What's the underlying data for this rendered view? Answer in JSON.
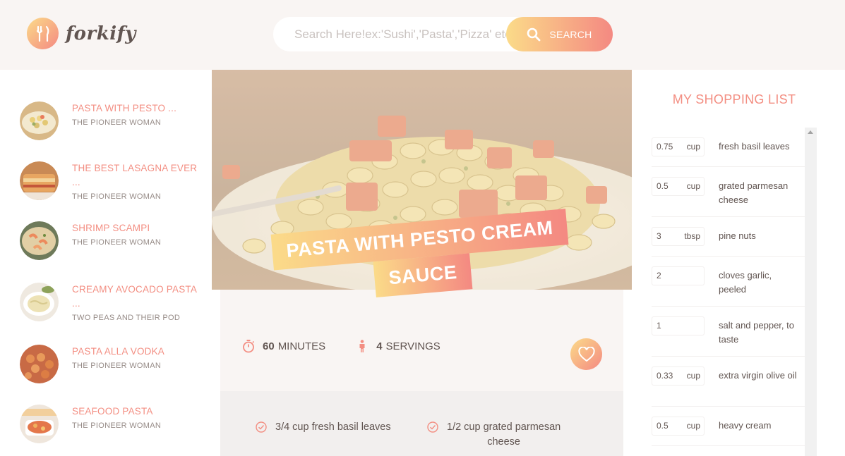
{
  "brand": {
    "name": "forkify",
    "gradient_start": "#fbdb89",
    "gradient_end": "#f48982",
    "accent": "#f38e82"
  },
  "search": {
    "placeholder": "Search Here!ex:'Sushi','Pasta','Pizza' etc",
    "button_label": "SEARCH",
    "icon": "search-icon"
  },
  "results": [
    {
      "title": "PASTA WITH PESTO ...",
      "author": "THE PIONEER WOMAN",
      "palette": "pasta-pesto"
    },
    {
      "title": "THE BEST LASAGNA EVER ...",
      "author": "THE PIONEER WOMAN",
      "palette": "lasagna"
    },
    {
      "title": "SHRIMP SCAMPI",
      "author": "THE PIONEER WOMAN",
      "palette": "shrimp"
    },
    {
      "title": "CREAMY AVOCADO PASTA ...",
      "author": "TWO PEAS AND THEIR POD",
      "palette": "avocado"
    },
    {
      "title": "PASTA ALLA VODKA",
      "author": "THE PIONEER WOMAN",
      "palette": "vodka"
    },
    {
      "title": "SEAFOOD PASTA",
      "author": "THE PIONEER WOMAN",
      "palette": "seafood"
    }
  ],
  "recipe": {
    "title_line1": "PASTA WITH PESTO CREAM",
    "title_line2": "SAUCE",
    "minutes": "60",
    "minutes_label": "MINUTES",
    "servings": "4",
    "servings_label": "SERVINGS",
    "ingredients": [
      {
        "text_line1": "3/4 cup fresh basil leaves",
        "text_line2": ""
      },
      {
        "text_line1": "1/2 cup grated parmesan",
        "text_line2": "cheese"
      }
    ]
  },
  "shopping": {
    "title": "MY SHOPPING LIST",
    "items": [
      {
        "count": "0.75",
        "unit": "cup",
        "desc": "fresh basil leaves"
      },
      {
        "count": "0.5",
        "unit": "cup",
        "desc": "grated parmesan cheese"
      },
      {
        "count": "3",
        "unit": "tbsp",
        "desc": "pine nuts"
      },
      {
        "count": "2",
        "unit": "",
        "desc": "cloves garlic, peeled"
      },
      {
        "count": "1",
        "unit": "",
        "desc": "salt and pepper, to taste"
      },
      {
        "count": "0.33",
        "unit": "cup",
        "desc": "extra virgin olive oil"
      },
      {
        "count": "0.5",
        "unit": "cup",
        "desc": "heavy cream"
      }
    ]
  }
}
